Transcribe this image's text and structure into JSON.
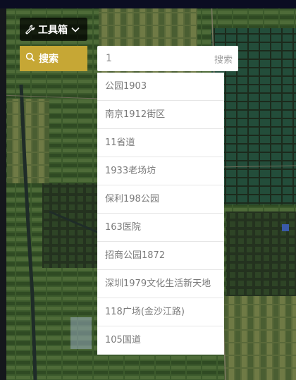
{
  "toolbar": {
    "toolbox_label": "工具箱",
    "toolbox_icon": "wrench-icon",
    "toolbox_caret": "chevron-down-icon"
  },
  "search": {
    "button_label": "搜索",
    "button_icon": "search-icon",
    "input_value": "1",
    "submit_label": "搜索",
    "accent_color": "#c6a735"
  },
  "suggestions": [
    "公园1903",
    "南京1912街区",
    "11省道",
    "1933老场坊",
    "保利198公园",
    "163医院",
    "招商公园1872",
    "深圳1979文化生活新天地",
    "118广场(金沙江路)",
    "105国道"
  ]
}
